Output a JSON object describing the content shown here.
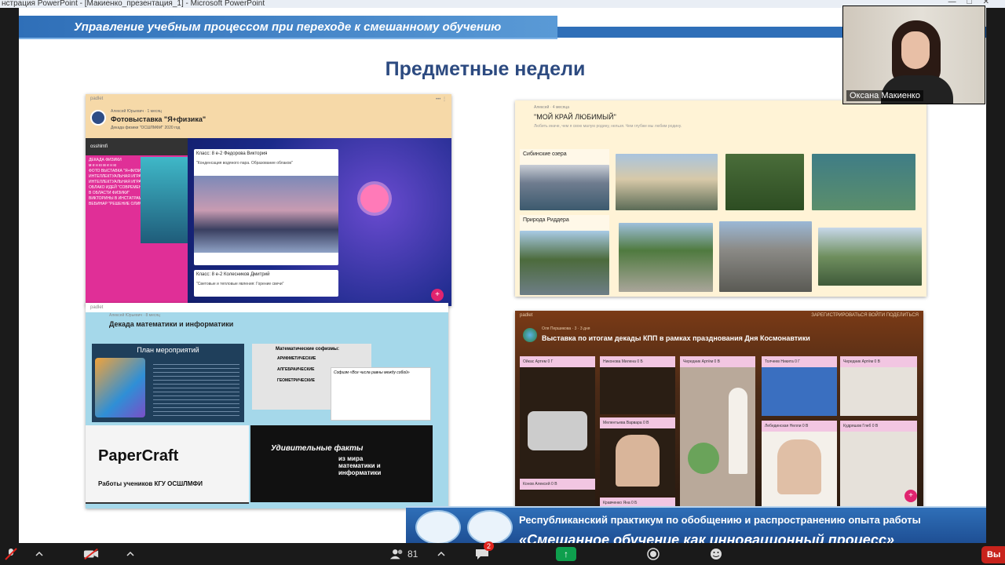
{
  "window": {
    "title": "нстрация PowerPoint - [Макиенко_презентация_1] - Microsoft PowerPoint",
    "controls": [
      "—",
      "□",
      "✕"
    ]
  },
  "slide": {
    "header_text": "Управление учебным процессом при переходе к смешанному обучению",
    "title": "Предметные недели",
    "panels": {
      "physics": {
        "brand": "padlet",
        "author": "Алексей Юрьевич · 1 месяц",
        "title": "Фотовыставка \"Я+физика\"",
        "subtitle": "Декада физики \"ОСШЛМФИ\" 2020 год",
        "menu_user": "osshlmfi",
        "menu_items": [
          "ДЕКАДА ФИЗИКИ",
          "м е н ю м е н ю",
          "ФОТО ВЫСТАВКА \"Я+ФИЗИКА\"",
          "ИНТЕЛЛЕКТУАЛЬНАЯ ИГРА \"ЭМАКИ\"",
          "ИНТЕЛЛЕКТУАЛЬНАЯ ИГРА \"ГДЕ ЛОГИКА?\"",
          "ОБЛАКО ИДЕЙ \"СОВРЕМЕННЫЕ ИЗОБРЕТЕНИЯ В ОБЛАСТИ ФИЗИКИ\"",
          "ВИКТОРИНЫ В ИНСТАГРАМ",
          "ВЕБИНАР \"РЕШЕНИЕ ОЛИМПИАДНЫХ ЗАДАЧ\""
        ],
        "card1_title": "Класс: 8 е-2 Федорова Виктория",
        "card1_text": "\"Конденсация водяного пара. Образование облаков\"",
        "card2_title": "Класс: 8 е-2 Колесников Дмитрий",
        "card2_text": "\"Световые и тепловые явления: Горение свечи\""
      },
      "homeland": {
        "author": "Алексей · 4 месяца",
        "title": "\"МОЙ КРАЙ ЛЮБИМЫЙ\"",
        "subtitle": "Любить иначе, чем я свою малую родину, нельзя. Чем глубже мы любим родину.",
        "label1": "Сибинские озера",
        "label2": "Природа Риддера"
      },
      "math": {
        "brand": "padlet",
        "author": "Алексей Юрьевич · 8 месяц",
        "title": "Декада математики и информатики",
        "plan_title": "План мероприятий",
        "sophisms_title": "Математические софизмы:",
        "sophisms": [
          "АРИФМЕТИЧЕСКИЕ",
          "АЛГЕБРАИЧЕСКИЕ",
          "ГЕОМЕТРИЧЕСКИЕ"
        ],
        "popup_title": "Софизм «Все числа равны между собой»",
        "papercraft": "PaperCraft",
        "papercraft_caption": "Работы учеников КГУ ОСШЛМФИ",
        "facts_title": "Удивительные факты",
        "facts_sub": "из мира математики и информатики"
      },
      "cosmo": {
        "brand": "padlet",
        "author": "Оля Першикова · 3 · 3 дня",
        "title": "Выставка по итогам декады КПП в рамках празднования Дня Космонавтики",
        "actions": [
          "ЗАРЕГИСТРИРОВАТЬСЯ",
          "ВОЙТИ",
          "ПОДЕЛИТЬСЯ"
        ],
        "names": [
          "Ойкас Артем 0 Г",
          "Никонова Милена 0 Б",
          "Чередник Артём 0 В",
          "Толчеев Никита 0 Г",
          "Чередник Артём 0 В",
          "Мелентьева Варвара 0 В",
          "Лебединская Нелли 0 В",
          "Кудряшов Глеб 0 В",
          "Конов Алексей 0 В",
          "Кравченко Яна 0 Б"
        ]
      }
    },
    "footer": {
      "line1": "Республиканский практикум по обобщению и распространению опыта работы",
      "line2": "«Смешанное обучение как инновационный процесс»"
    }
  },
  "video": {
    "participant_name": "Оксана Макиенко"
  },
  "toolbar": {
    "participants_count": "81",
    "chat_badge": "2",
    "end_label": "Вы"
  },
  "colors": {
    "slide_blue": "#2f6fb8",
    "title_blue": "#2c4a80",
    "share_green": "#0e9f4d",
    "end_red": "#c8231c"
  }
}
